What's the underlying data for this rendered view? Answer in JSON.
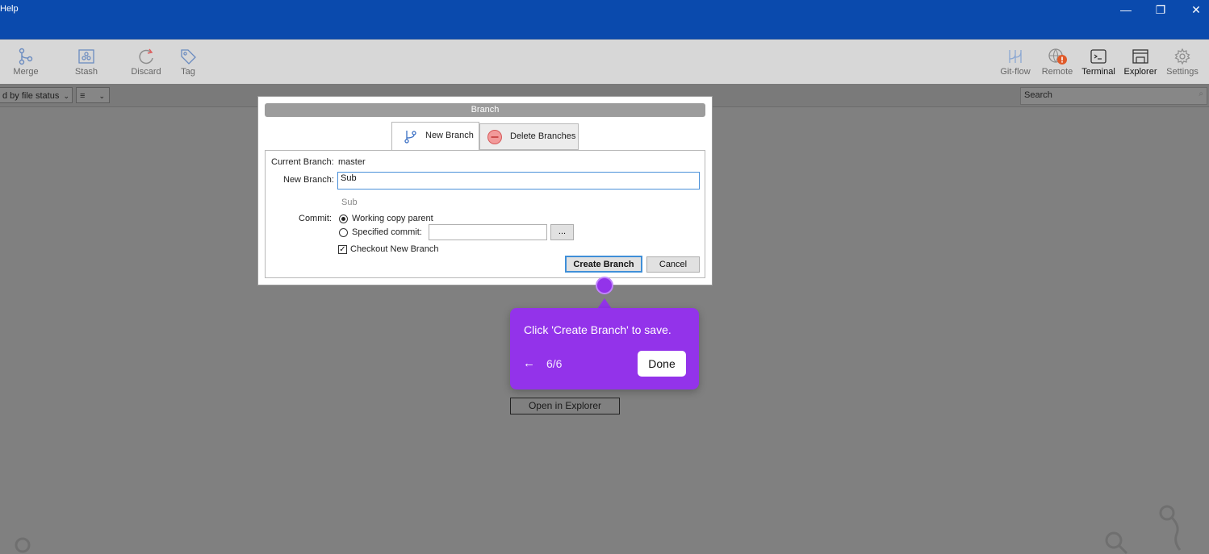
{
  "menu": {
    "help": "Help"
  },
  "window": {
    "minimize_glyph": "—",
    "restore_glyph": "❐",
    "close_glyph": "✕"
  },
  "toolbar": {
    "left": [
      {
        "label": "Merge",
        "icon": "merge-icon"
      },
      {
        "label": "Stash",
        "icon": "stash-icon"
      },
      {
        "label": "Discard",
        "icon": "discard-icon"
      },
      {
        "label": "Tag",
        "icon": "tag-icon"
      }
    ],
    "right": [
      {
        "label": "Git-flow",
        "icon": "git-flow-icon"
      },
      {
        "label": "Remote",
        "icon": "remote-icon"
      },
      {
        "label": "Terminal",
        "icon": "terminal-icon"
      },
      {
        "label": "Explorer",
        "icon": "explorer-icon"
      },
      {
        "label": "Settings",
        "icon": "gear-icon"
      }
    ]
  },
  "filterbar": {
    "sort_label": "d by file status",
    "view_glyph": "≡",
    "search_placeholder": "Search"
  },
  "dialog": {
    "title": "Branch",
    "tabs": {
      "new": "New Branch",
      "delete": "Delete Branches"
    },
    "current_branch_label": "Current Branch:",
    "current_branch_value": "master",
    "new_branch_label": "New Branch:",
    "new_branch_value": "Sub",
    "preview": "Sub",
    "commit_label": "Commit:",
    "radio_working": "Working copy parent",
    "radio_specified": "Specified commit:",
    "browse_button": "...",
    "checkout_label": "Checkout New Branch",
    "checkout_checked": true,
    "create_button": "Create Branch",
    "cancel_button": "Cancel"
  },
  "tour": {
    "text": "Click 'Create Branch' to save.",
    "back_glyph": "←",
    "step": "6/6",
    "done_button": "Done"
  },
  "main": {
    "open_explorer_button": "Open in Explorer"
  },
  "colors": {
    "titlebar": "#0a4aad",
    "tour_accent": "#9333ea",
    "overlay": "#808080"
  }
}
